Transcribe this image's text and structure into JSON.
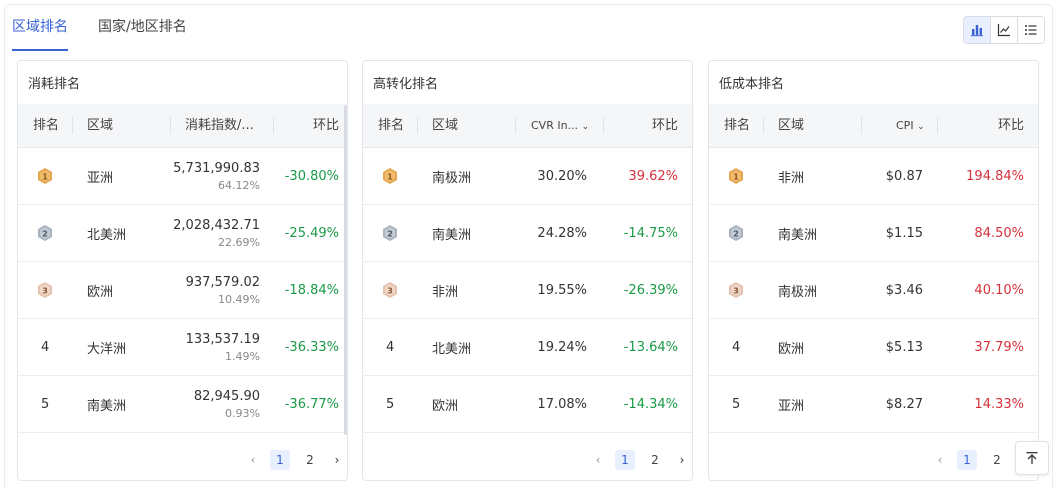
{
  "tabs": [
    {
      "label": "区域排名",
      "active": true
    },
    {
      "label": "国家/地区排名",
      "active": false
    }
  ],
  "view_switch": {
    "icons": [
      "bar-chart-icon",
      "line-chart-icon",
      "list-icon"
    ],
    "active": 0
  },
  "colors": {
    "accent": "#3a63d2",
    "negative": "#1a9a46",
    "positive": "#d6313b"
  },
  "cards": [
    {
      "title": "消耗排名",
      "columns": {
        "rank": "排名",
        "region": "区域",
        "metric": "消耗指数/...",
        "change": "环比"
      },
      "rows": [
        {
          "rank": "1",
          "region": "亚洲",
          "value": "5,731,990.83",
          "share": "64.12%",
          "change": "-30.80%",
          "dir": "neg"
        },
        {
          "rank": "2",
          "region": "北美洲",
          "value": "2,028,432.71",
          "share": "22.69%",
          "change": "-25.49%",
          "dir": "neg"
        },
        {
          "rank": "3",
          "region": "欧洲",
          "value": "937,579.02",
          "share": "10.49%",
          "change": "-18.84%",
          "dir": "neg"
        },
        {
          "rank": "4",
          "region": "大洋洲",
          "value": "133,537.19",
          "share": "1.49%",
          "change": "-36.33%",
          "dir": "neg"
        },
        {
          "rank": "5",
          "region": "南美洲",
          "value": "82,945.90",
          "share": "0.93%",
          "change": "-36.77%",
          "dir": "neg"
        }
      ],
      "pager": {
        "pages": [
          "1",
          "2"
        ],
        "current": "1",
        "prev": "‹",
        "next": "›"
      }
    },
    {
      "title": "高转化排名",
      "columns": {
        "rank": "排名",
        "region": "区域",
        "metric": "CVR In...",
        "change": "环比"
      },
      "rows": [
        {
          "rank": "1",
          "region": "南极洲",
          "value": "30.20%",
          "change": "39.62%",
          "dir": "pos"
        },
        {
          "rank": "2",
          "region": "南美洲",
          "value": "24.28%",
          "change": "-14.75%",
          "dir": "neg"
        },
        {
          "rank": "3",
          "region": "非洲",
          "value": "19.55%",
          "change": "-26.39%",
          "dir": "neg"
        },
        {
          "rank": "4",
          "region": "北美洲",
          "value": "19.24%",
          "change": "-13.64%",
          "dir": "neg"
        },
        {
          "rank": "5",
          "region": "欧洲",
          "value": "17.08%",
          "change": "-14.34%",
          "dir": "neg"
        }
      ],
      "pager": {
        "pages": [
          "1",
          "2"
        ],
        "current": "1",
        "prev": "‹",
        "next": "›"
      }
    },
    {
      "title": "低成本排名",
      "columns": {
        "rank": "排名",
        "region": "区域",
        "metric": "CPI",
        "change": "环比"
      },
      "rows": [
        {
          "rank": "1",
          "region": "非洲",
          "value": "$0.87",
          "change": "194.84%",
          "dir": "pos"
        },
        {
          "rank": "2",
          "region": "南美洲",
          "value": "$1.15",
          "change": "84.50%",
          "dir": "pos"
        },
        {
          "rank": "3",
          "region": "南极洲",
          "value": "$3.46",
          "change": "40.10%",
          "dir": "pos"
        },
        {
          "rank": "4",
          "region": "欧洲",
          "value": "$5.13",
          "change": "37.79%",
          "dir": "pos"
        },
        {
          "rank": "5",
          "region": "亚洲",
          "value": "$8.27",
          "change": "14.33%",
          "dir": "pos"
        }
      ],
      "pager": {
        "pages": [
          "1",
          "2"
        ],
        "current": "1",
        "prev": "‹",
        "next": "›"
      }
    }
  ],
  "back_to_top": {
    "icon": "arrow-up-to-top-icon"
  }
}
